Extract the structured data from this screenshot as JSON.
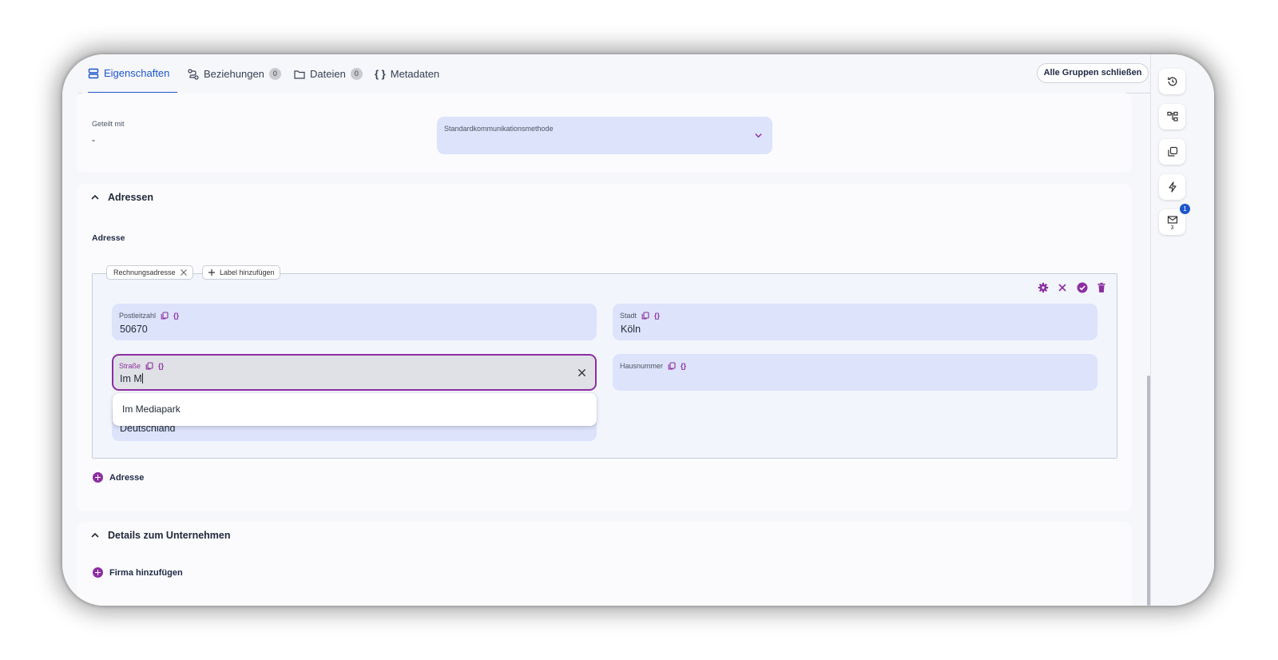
{
  "tabs": [
    {
      "label": "Eigenschaften",
      "icon": "rows-icon",
      "active": true
    },
    {
      "label": "Beziehungen",
      "icon": "relation-icon",
      "count": "0"
    },
    {
      "label": "Dateien",
      "icon": "folder-icon",
      "count": "0"
    },
    {
      "label": "Metadaten",
      "icon": "braces-icon"
    }
  ],
  "toolbar": {
    "close_groups_label": "Alle Gruppen schließen"
  },
  "general": {
    "shared_with_label": "Geteilt mit",
    "shared_with_value": "-",
    "comm_method_label": "Standardkommunikationsmethode"
  },
  "addresses": {
    "section_title": "Adressen",
    "subheading": "Adresse",
    "chip_label": "Rechnungsadresse",
    "add_label_button": "Label hinzufügen",
    "fields": {
      "postal_code": {
        "label": "Postleitzahl",
        "value": "50670"
      },
      "city": {
        "label": "Stadt",
        "value": "Köln"
      },
      "street": {
        "label": "Straße",
        "value": "Im M"
      },
      "house_number": {
        "label": "Hausnummer",
        "value": ""
      },
      "country": {
        "value": "Deutschland"
      }
    },
    "suggestion": "Im Mediapark",
    "add_address_label": "Adresse"
  },
  "company": {
    "section_title": "Details zum Unternehmen",
    "add_company_label": "Firma hinzufügen"
  },
  "rail": {
    "mail_badge": "1",
    "mail_count": "3"
  },
  "colors": {
    "accent_blue": "#1d56c9",
    "accent_purple": "#8b2fa0",
    "field_bg": "#dde3fb"
  }
}
